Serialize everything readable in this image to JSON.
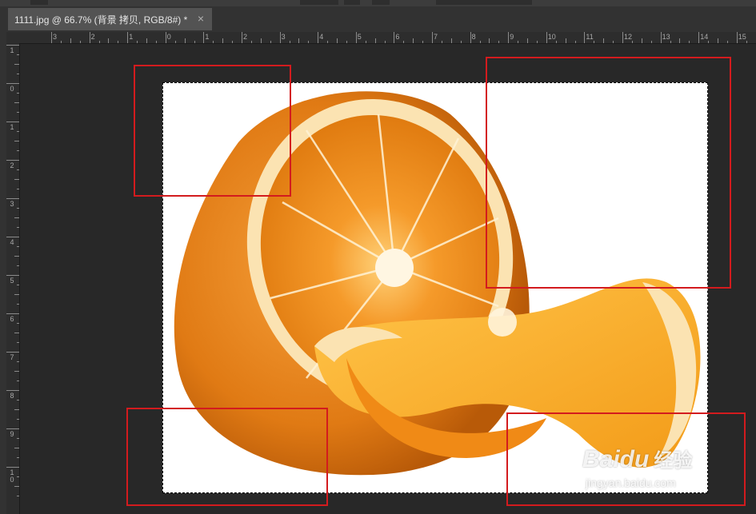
{
  "document_tab": {
    "title": "1111.jpg @ 66.7% (背景 拷贝, RGB/8#) *",
    "close": "×"
  },
  "ruler": {
    "horizontal": [
      "3",
      "2",
      "1",
      "0",
      "1",
      "2",
      "3",
      "4",
      "5",
      "6",
      "7",
      "8",
      "9",
      "10",
      "11",
      "12",
      "13",
      "14",
      "15"
    ],
    "vertical": [
      "1",
      "0",
      "1",
      "2",
      "3",
      "4",
      "5",
      "6",
      "7",
      "8",
      "9",
      "1\n0"
    ]
  },
  "image": {
    "subject": "sliced orange with selection marquee",
    "background": "#ffffff"
  },
  "annotations": {
    "color": "#d31b1e",
    "count": 4
  },
  "watermark": {
    "logo": "Baidu",
    "text": "经验",
    "url": "jingyan.baidu.com"
  }
}
